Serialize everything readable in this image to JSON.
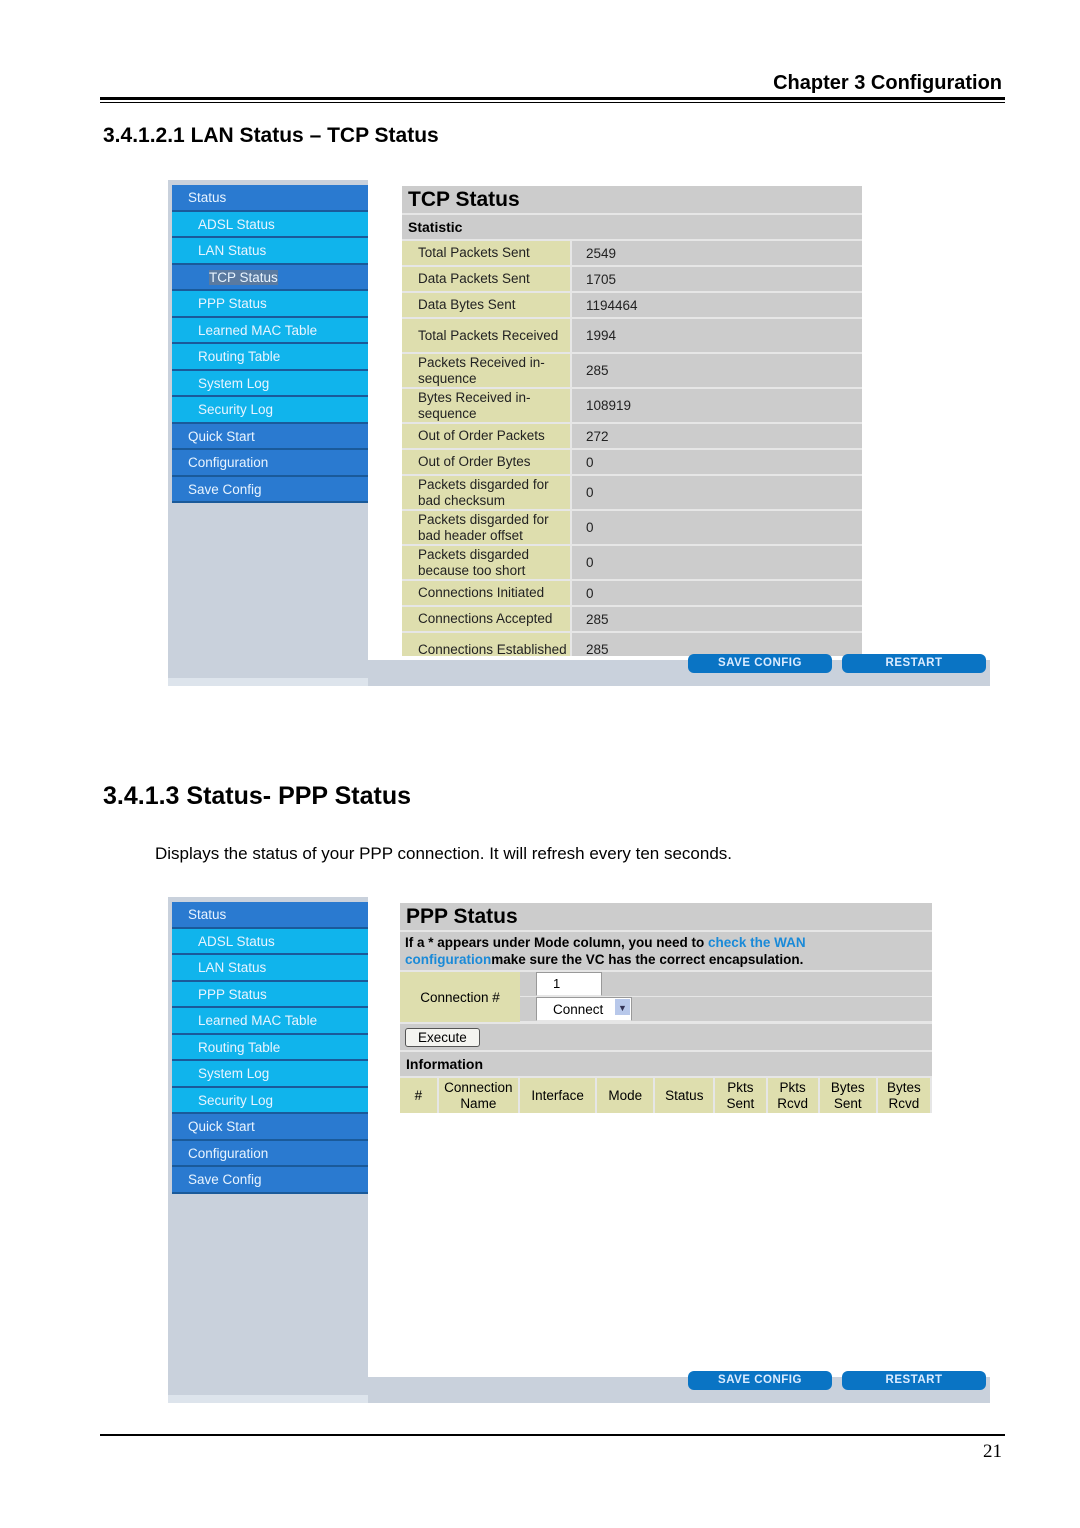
{
  "header": {
    "chapter": "Chapter 3 Configuration"
  },
  "section1": {
    "title": "3.4.1.2.1 LAN Status – TCP Status"
  },
  "section2": {
    "title": "3.4.1.3 Status- PPP Status",
    "description": "Displays the status of your PPP connection. It will refresh every ten seconds."
  },
  "page_number": "21",
  "colors": {
    "nav_dark": "#2a7ad0",
    "nav_light": "#10b4ec",
    "label_bg": "#dedeae",
    "panel_bg": "#cccccc",
    "button": "#0a74c4"
  },
  "shot1": {
    "nav": [
      {
        "label": "Status",
        "level": "top"
      },
      {
        "label": "ADSL Status",
        "level": "sub"
      },
      {
        "label": "LAN Status",
        "level": "sub"
      },
      {
        "label": "TCP Status",
        "level": "sub2"
      },
      {
        "label": "PPP Status",
        "level": "sub"
      },
      {
        "label": "Learned MAC Table",
        "level": "sub"
      },
      {
        "label": "Routing Table",
        "level": "sub"
      },
      {
        "label": "System Log",
        "level": "sub"
      },
      {
        "label": "Security Log",
        "level": "sub"
      },
      {
        "label": "Quick Start",
        "level": "top"
      },
      {
        "label": "Configuration",
        "level": "top"
      },
      {
        "label": "Save Config",
        "level": "top"
      }
    ],
    "title": "TCP Status",
    "section": "Statistic",
    "rows": [
      {
        "label": "Total Packets Sent",
        "value": "2549"
      },
      {
        "label": "Data Packets Sent",
        "value": "1705"
      },
      {
        "label": "Data Bytes Sent",
        "value": "1194464"
      },
      {
        "label": "Total Packets Received",
        "value": "1994",
        "two": true
      },
      {
        "label": "Packets Received in-sequence",
        "value": "285",
        "two": true
      },
      {
        "label": "Bytes Received in-sequence",
        "value": "108919",
        "two": true
      },
      {
        "label": "Out of Order Packets",
        "value": "272"
      },
      {
        "label": "Out of Order Bytes",
        "value": "0"
      },
      {
        "label": "Packets disgarded for bad checksum",
        "value": "0",
        "two": true
      },
      {
        "label": "Packets disgarded for bad header offset",
        "value": "0",
        "two": true
      },
      {
        "label": "Packets disgarded because too short",
        "value": "0",
        "two": true
      },
      {
        "label": "Connections Initiated",
        "value": "0"
      },
      {
        "label": "Connections Accepted",
        "value": "285"
      },
      {
        "label": "Connections Established",
        "value": "285",
        "two": true
      }
    ],
    "save_label": "SAVE CONFIG",
    "restart_label": "RESTART"
  },
  "shot2": {
    "nav": [
      {
        "label": "Status",
        "level": "top"
      },
      {
        "label": "ADSL Status",
        "level": "sub"
      },
      {
        "label": "LAN Status",
        "level": "sub"
      },
      {
        "label": "PPP Status",
        "level": "sub"
      },
      {
        "label": "Learned MAC Table",
        "level": "sub"
      },
      {
        "label": "Routing Table",
        "level": "sub"
      },
      {
        "label": "System Log",
        "level": "sub"
      },
      {
        "label": "Security Log",
        "level": "sub"
      },
      {
        "label": "Quick Start",
        "level": "top"
      },
      {
        "label": "Configuration",
        "level": "top"
      },
      {
        "label": "Save Config",
        "level": "top"
      }
    ],
    "title": "PPP Status",
    "note_pre": "If a * appears under Mode column, you need to ",
    "note_link": "check the WAN configuration",
    "note_post": "make sure the VC has the correct encapsulation.",
    "connection_label": "Connection #",
    "connection_value": "1",
    "action_value": "Connect",
    "execute_label": "Execute",
    "info_label": "Information",
    "columns": [
      "#",
      "Connection Name",
      "Interface",
      "Mode",
      "Status",
      "Pkts Sent",
      "Pkts Rcvd",
      "Bytes Sent",
      "Bytes Rcvd"
    ],
    "save_label": "SAVE CONFIG",
    "restart_label": "RESTART"
  }
}
